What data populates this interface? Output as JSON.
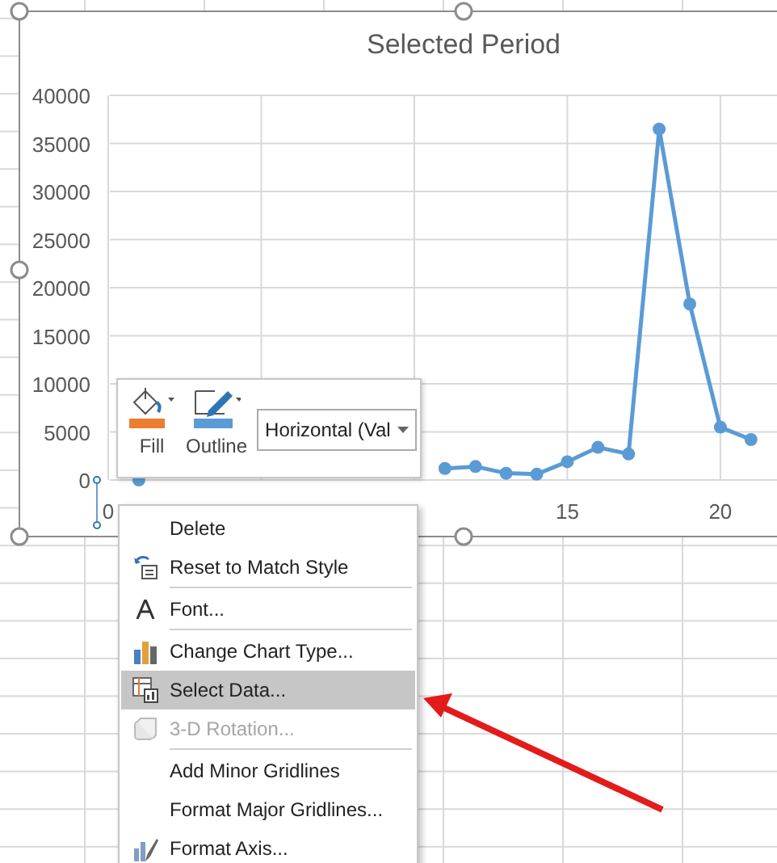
{
  "chart": {
    "chart_data": {
      "type": "line",
      "title": "Selected Period",
      "x": [
        1,
        2,
        3,
        4,
        5,
        6,
        7,
        8,
        9,
        10,
        11,
        12,
        13,
        14,
        15,
        16,
        17,
        18,
        19,
        20,
        21
      ],
      "series": [
        {
          "color": "#5b9bd5",
          "marker": true,
          "values": [
            0,
            null,
            null,
            null,
            null,
            null,
            null,
            null,
            null,
            null,
            1200,
            1400,
            700,
            600,
            1900,
            3400,
            2700,
            36500,
            18300,
            5500,
            4200
          ]
        }
      ],
      "grid": true,
      "xlim": [
        0,
        21.85
      ],
      "ylim": [
        0,
        40000
      ],
      "xticks": [
        0,
        15,
        20
      ],
      "yticks": [
        0,
        5000,
        10000,
        15000,
        20000,
        25000,
        30000,
        35000,
        40000
      ]
    }
  },
  "format_toolbar": {
    "buttons": [
      {
        "label": "Fill",
        "color": "#ed7d31"
      },
      {
        "label": "Outline",
        "color": "#5b9bd5"
      }
    ],
    "element_dropdown": {
      "value": "Horizontal (Val"
    }
  },
  "context_menu": {
    "items": [
      {
        "label": "Delete",
        "separator_before": false,
        "disabled": false,
        "selected": false
      },
      {
        "label": "Reset to Match Style",
        "separator_before": false,
        "disabled": false,
        "selected": false
      },
      {
        "label": "Font...",
        "separator_before": true,
        "disabled": false,
        "selected": false
      },
      {
        "label": "Change Chart Type...",
        "separator_before": true,
        "disabled": false,
        "selected": false
      },
      {
        "label": "Select Data...",
        "separator_before": false,
        "disabled": false,
        "selected": true
      },
      {
        "label": "3-D Rotation...",
        "separator_before": false,
        "disabled": true,
        "selected": false
      },
      {
        "label": "Add Minor Gridlines",
        "separator_before": true,
        "disabled": false,
        "selected": false
      },
      {
        "label": "Format Major Gridlines...",
        "separator_before": false,
        "disabled": false,
        "selected": false
      },
      {
        "label": "Format Axis...",
        "separator_before": false,
        "disabled": false,
        "selected": false
      }
    ]
  }
}
